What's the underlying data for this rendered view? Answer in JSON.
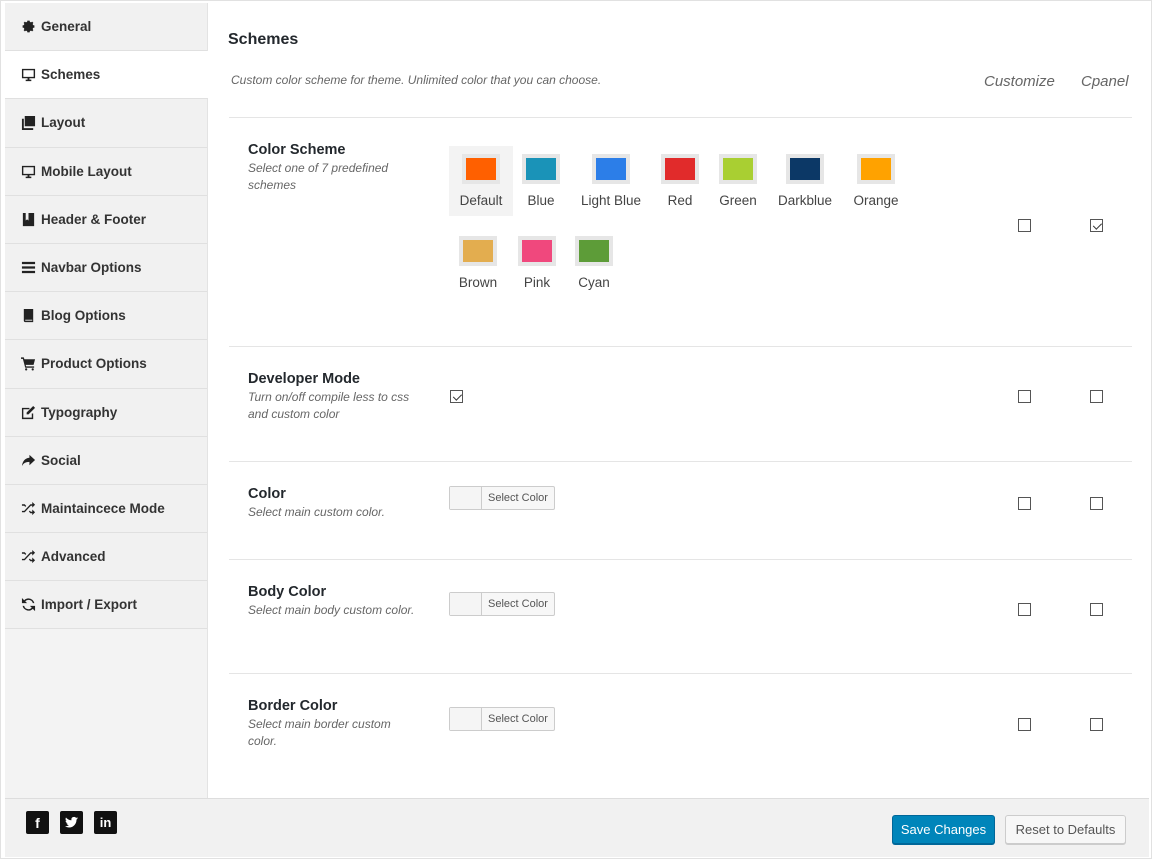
{
  "sidebar": {
    "items": [
      {
        "label": "General",
        "icon": "gear-icon"
      },
      {
        "label": "Schemes",
        "icon": "monitor-icon",
        "active": true
      },
      {
        "label": "Layout",
        "icon": "layers-icon"
      },
      {
        "label": "Mobile Layout",
        "icon": "monitor-icon"
      },
      {
        "label": "Header & Footer",
        "icon": "bookmark-icon"
      },
      {
        "label": "Navbar Options",
        "icon": "menu-icon"
      },
      {
        "label": "Blog Options",
        "icon": "book-icon"
      },
      {
        "label": "Product Options",
        "icon": "cart-icon"
      },
      {
        "label": "Typography",
        "icon": "edit-icon"
      },
      {
        "label": "Social",
        "icon": "share-icon"
      },
      {
        "label": "Maintaincece Mode",
        "icon": "shuffle-icon"
      },
      {
        "label": "Advanced",
        "icon": "shuffle-icon"
      },
      {
        "label": "Import / Export",
        "icon": "refresh-icon"
      }
    ]
  },
  "main": {
    "title": "Schemes",
    "description": "Custom color scheme for theme. Unlimited color that you can choose.",
    "columns": {
      "customize": "Customize",
      "cpanel": "Cpanel"
    },
    "color_scheme": {
      "title": "Color Scheme",
      "subtitle": "Select one of 7 predefined schemes",
      "selected": "Default",
      "swatches": [
        {
          "label": "Default",
          "color": "#ff6000"
        },
        {
          "label": "Blue",
          "color": "#1a93b8"
        },
        {
          "label": "Light Blue",
          "color": "#2c7ee8"
        },
        {
          "label": "Red",
          "color": "#e12b2b"
        },
        {
          "label": "Green",
          "color": "#a9cf32"
        },
        {
          "label": "Darkblue",
          "color": "#0c3866"
        },
        {
          "label": "Orange",
          "color": "#ffa200"
        },
        {
          "label": "Brown",
          "color": "#e3ad4f"
        },
        {
          "label": "Pink",
          "color": "#f0487d"
        },
        {
          "label": "Cyan",
          "color": "#5d9c38"
        }
      ],
      "customize_checked": false,
      "cpanel_checked": true
    },
    "developer_mode": {
      "title": "Developer Mode",
      "subtitle": "Turn on/off compile less to css and custom color",
      "enabled": true,
      "customize_checked": false,
      "cpanel_checked": false
    },
    "color": {
      "title": "Color",
      "subtitle": "Select main custom color.",
      "button_label": "Select Color",
      "customize_checked": false,
      "cpanel_checked": false
    },
    "body_color": {
      "title": "Body Color",
      "subtitle": "Select main body custom color.",
      "button_label": "Select Color",
      "customize_checked": false,
      "cpanel_checked": false
    },
    "border_color": {
      "title": "Border Color",
      "subtitle": "Select main border custom color.",
      "button_label": "Select Color",
      "customize_checked": false,
      "cpanel_checked": false
    }
  },
  "footer": {
    "social": [
      "facebook-icon",
      "twitter-icon",
      "linkedin-icon"
    ],
    "save_label": "Save Changes",
    "reset_label": "Reset to Defaults"
  },
  "colors": {
    "primary_button": "#0085ba"
  }
}
